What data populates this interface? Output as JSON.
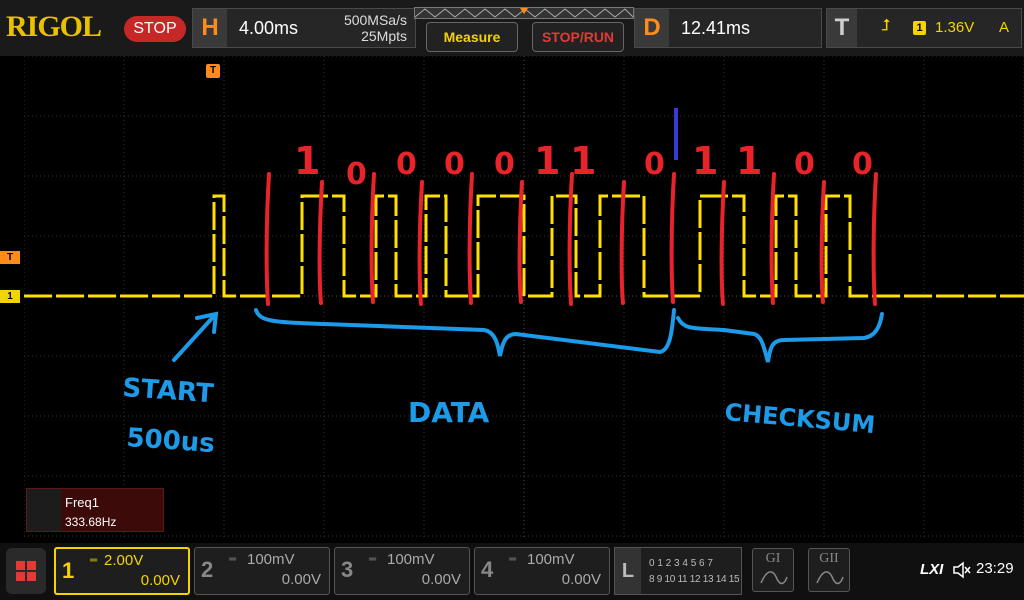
{
  "topbar": {
    "brand": "RIGOL",
    "run_state": "STOP",
    "horizontal": {
      "letter": "H",
      "timebase": "4.00ms",
      "sample_rate": "500MSa/s",
      "memory_depth": "25Mpts"
    },
    "measure_label": "Measure",
    "stop_run_label": "STOP/RUN",
    "delay": {
      "letter": "D",
      "value": "12.41ms"
    },
    "trigger": {
      "letter": "T",
      "edge_symbol": "⮥",
      "source": "1",
      "level": "1.36V",
      "mode": "A"
    }
  },
  "scope": {
    "trigger_marker": "T",
    "channel_marker": "1",
    "annotations": {
      "bits": [
        "1",
        "0",
        "0",
        "0",
        "0",
        "1",
        "1",
        "0",
        "1",
        "1",
        "0",
        "0"
      ],
      "start_label_line1": "START",
      "start_label_line2": "500us",
      "data_label": "DATA",
      "checksum_label": "CHECKSUM"
    },
    "colors": {
      "trace": "#ffe000",
      "annotation_red": "#e8242a",
      "annotation_blue": "#1d9be8",
      "cursor": "#3a3ad8"
    }
  },
  "measurement": {
    "label": "Freq1",
    "value": "333.68Hz"
  },
  "channels": [
    {
      "num": "1",
      "scale": "2.00V",
      "offset": "0.00V",
      "color": "#f4d400"
    },
    {
      "num": "2",
      "scale": "100mV",
      "offset": "0.00V",
      "color": "#888888"
    },
    {
      "num": "3",
      "scale": "100mV",
      "offset": "0.00V",
      "color": "#888888"
    },
    {
      "num": "4",
      "scale": "100mV",
      "offset": "0.00V",
      "color": "#888888"
    }
  ],
  "logic": {
    "letter": "L",
    "row1": "0 1 2 3  4 5 6 7",
    "row2": "8 9 10 11 12 13 14 15"
  },
  "decoders": [
    {
      "label": "GI"
    },
    {
      "label": "GII"
    }
  ],
  "status": {
    "lxi": "LXI",
    "time": "23:29"
  }
}
